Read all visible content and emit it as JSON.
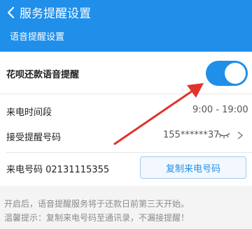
{
  "header": {
    "nav_title": "服务提醒设置",
    "section_title": "语音提醒设置"
  },
  "settings": {
    "toggle_label": "花呗还款语音提醒",
    "toggle_on": true,
    "time_label": "来电时间段",
    "time_value": "9:00 - 19:00",
    "phone_label": "接受提醒号码",
    "phone_value": "155******37",
    "incoming_label": "来电号码 02131115355",
    "copy_button": "复制来电号码"
  },
  "notes": {
    "line1": "开启后，语音提醒服务将于还款日前第三天开始。",
    "line2": "温馨提示：复制来电号码至通讯录，不漏接提醒！"
  },
  "colors": {
    "accent": "#1f8fea",
    "arrow": "#e0332e"
  },
  "icons": [
    "chevron-left-icon",
    "eye-closed-icon",
    "chevron-right-icon",
    "red-arrow-annotation"
  ]
}
